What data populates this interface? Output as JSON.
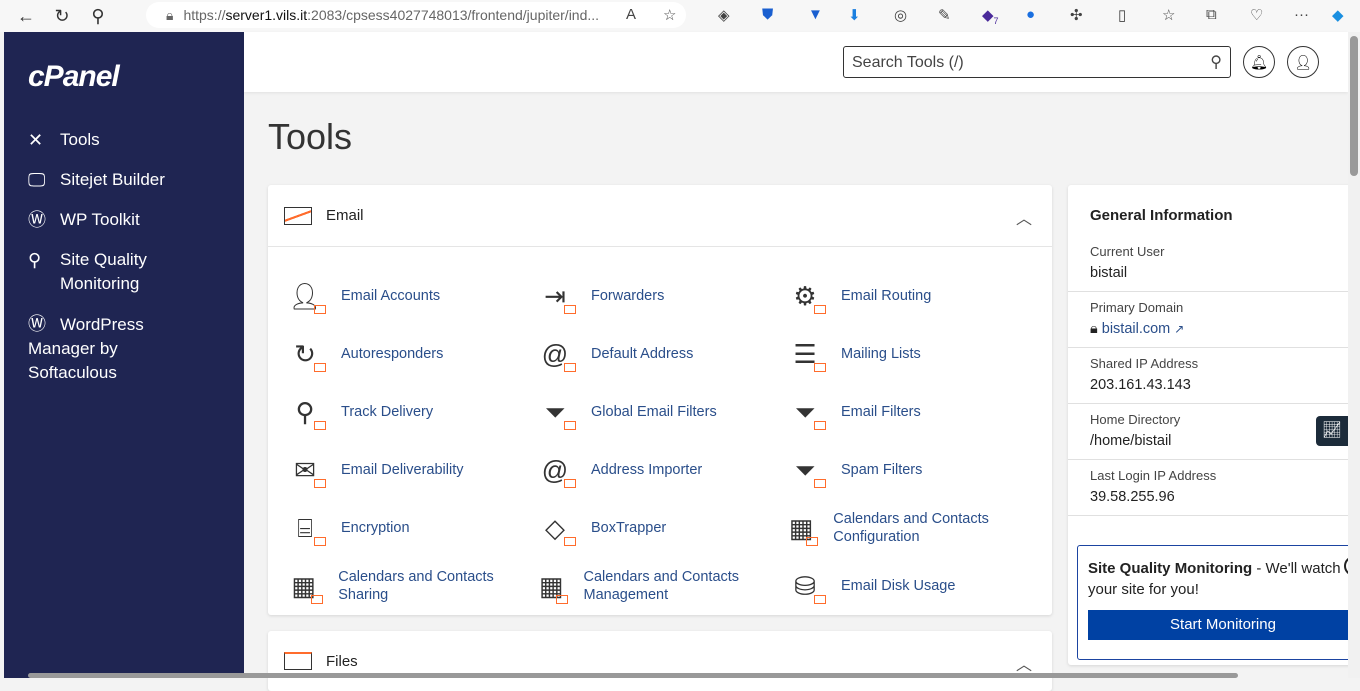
{
  "browser": {
    "url_prefix": "https://",
    "url_host": "server1.vils.it",
    "url_rest": ":2083/cpsess4027748013/frontend/jupiter/ind...",
    "extension_badge": "7"
  },
  "sidebar": {
    "logo": "cPanel",
    "items": [
      {
        "label": "Tools",
        "icon": "tools-icon"
      },
      {
        "label": "Sitejet Builder",
        "icon": "monitor-icon"
      },
      {
        "label": "WP Toolkit",
        "icon": "wordpress-icon"
      },
      {
        "label": "Site Quality Monitoring",
        "icon": "magnifier-icon"
      },
      {
        "label": "WordPress Manager by Softaculous",
        "icon": "wordpress-icon"
      }
    ]
  },
  "header": {
    "search_placeholder": "Search Tools (/)"
  },
  "page": {
    "title": "Tools"
  },
  "email": {
    "title": "Email",
    "items": [
      "Email Accounts",
      "Forwarders",
      "Email Routing",
      "Autoresponders",
      "Default Address",
      "Mailing Lists",
      "Track Delivery",
      "Global Email Filters",
      "Email Filters",
      "Email Deliverability",
      "Address Importer",
      "Spam Filters",
      "Encryption",
      "BoxTrapper",
      "Calendars and Contacts Configuration",
      "Calendars and Contacts Sharing",
      "Calendars and Contacts Management",
      "Email Disk Usage"
    ]
  },
  "files": {
    "title": "Files"
  },
  "general": {
    "title": "General Information",
    "rows": [
      {
        "label": "Current User",
        "value": "bistail"
      },
      {
        "label": "Primary Domain",
        "value": "bistail.com"
      },
      {
        "label": "Shared IP Address",
        "value": "203.161.43.143"
      },
      {
        "label": "Home Directory",
        "value": "/home/bistail"
      },
      {
        "label": "Last Login IP Address",
        "value": "39.58.255.96"
      }
    ]
  },
  "promo": {
    "bold": "Site Quality Monitoring",
    "text": " - We'll watch your site for you!",
    "button": "Start Monitoring"
  },
  "colors": {
    "sidebar": "#1f2552",
    "accent": "#ff6c2c",
    "link": "#2a4e8a",
    "button": "#0041a3"
  }
}
